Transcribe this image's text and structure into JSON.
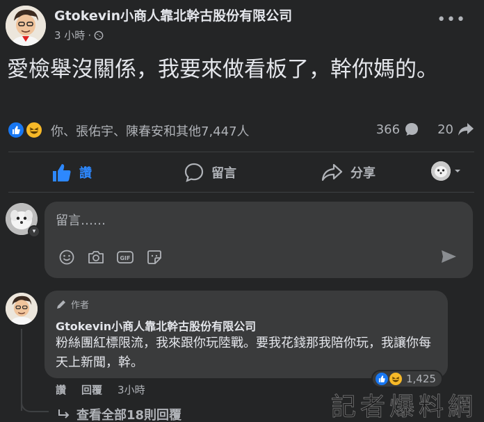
{
  "post": {
    "author": "Gtokevin小商人靠北幹古股份有限公司",
    "time": "3 小時",
    "privacy_icon": "globe-icon",
    "more_label": "•••",
    "text": "愛檢舉沒關係，我要來做看板了，幹你媽的。"
  },
  "stats": {
    "reactions": [
      "like",
      "haha"
    ],
    "names": "你、張佑宇、陳春安和其他7,447人",
    "comment_count": "366",
    "share_count": "20"
  },
  "actions": {
    "like_label": "讚",
    "comment_label": "留言",
    "share_label": "分享"
  },
  "composer": {
    "placeholder": "留言……",
    "tools": [
      "emoji-icon",
      "camera-icon",
      "gif-icon",
      "sticker-icon"
    ]
  },
  "comment": {
    "author_tag": "作者",
    "name": "Gtokevin小商人靠北幹古股份有限公司",
    "text": "粉絲團紅標限流，我來跟你玩陸戰。要我花錢那我陪你玩，我讓你每天上新聞，幹。",
    "reaction_count": "1,425",
    "like_label": "讚",
    "reply_label": "回覆",
    "time": "3小時",
    "view_replies": "查看全部18則回覆"
  },
  "watermark": "記者爆料網",
  "colors": {
    "background": "#242526",
    "bubble": "#3a3b3c",
    "accent": "#2d88ff",
    "text": "#e4e6eb",
    "secondary": "#b0b3b8"
  }
}
